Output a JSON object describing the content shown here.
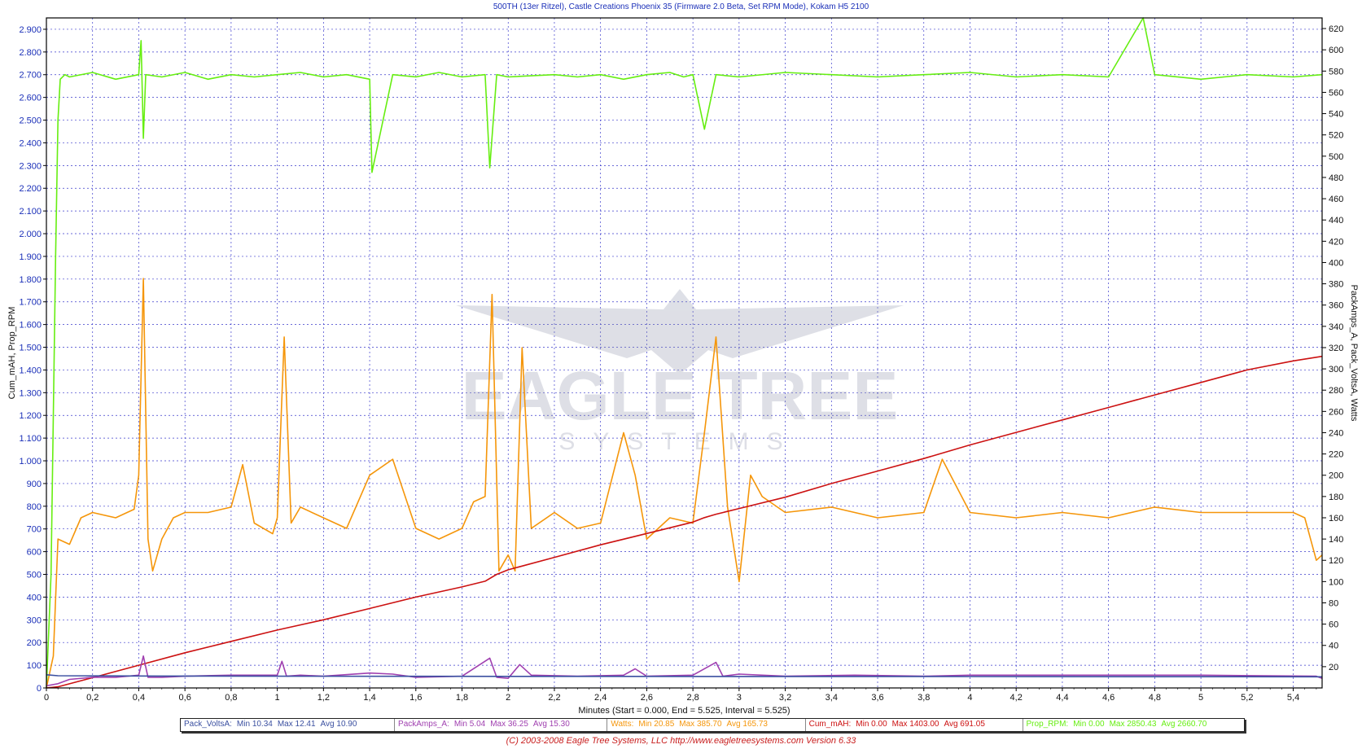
{
  "window": {
    "title": "500TH (13er Ritzel), Castle Creations Phoenix 35 (Firmware 2.0 Beta, Set RPM Mode), Kokam H5 2100"
  },
  "chart_data": {
    "type": "line",
    "title": "500TH (13er Ritzel), Castle Creations Phoenix 35 (Firmware 2.0 Beta, Set RPM Mode), Kokam H5 2100",
    "xlabel": "Minutes (Start = 0.000,  End = 5.525,  Interval =  5.525)",
    "ylabel_left": "Cum_mAH, Prop_RPM",
    "ylabel_right": "PackAmps_A, Pack_VoltsA, Watts",
    "xlim": [
      0,
      5.525
    ],
    "ylim_left": [
      0,
      2950
    ],
    "ylim_right": [
      0,
      630
    ],
    "x_ticks": [
      "0",
      "0,2",
      "0,4",
      "0,6",
      "0,8",
      "1",
      "1,2",
      "1,4",
      "1,6",
      "1,8",
      "2",
      "2,2",
      "2,4",
      "2,6",
      "2,8",
      "3",
      "3,2",
      "3,4",
      "3,6",
      "3,8",
      "4",
      "4,2",
      "4,4",
      "4,6",
      "4,8",
      "5",
      "5,2",
      "5,4"
    ],
    "y_left_ticks": [
      "0",
      "100",
      "200",
      "300",
      "400",
      "500",
      "600",
      "700",
      "800",
      "900",
      "1.000",
      "1.100",
      "1.200",
      "1.300",
      "1.400",
      "1.500",
      "1.600",
      "1.700",
      "1.800",
      "1.900",
      "2.000",
      "2.100",
      "2.200",
      "2.300",
      "2.400",
      "2.500",
      "2.600",
      "2.700",
      "2.800",
      "2.900"
    ],
    "y_right_ticks": [
      "20",
      "40",
      "60",
      "80",
      "100",
      "120",
      "140",
      "160",
      "180",
      "200",
      "220",
      "240",
      "260",
      "280",
      "300",
      "320",
      "340",
      "360",
      "380",
      "400",
      "420",
      "440",
      "460",
      "480",
      "500",
      "520",
      "540",
      "560",
      "580",
      "600",
      "620"
    ],
    "grid": true,
    "legend_position": "bottom",
    "series": [
      {
        "name": "Prop_RPM",
        "axis": "left",
        "color": "#66ee11",
        "x": [
          0,
          0.02,
          0.04,
          0.05,
          0.06,
          0.08,
          0.1,
          0.2,
          0.3,
          0.4,
          0.41,
          0.42,
          0.43,
          0.5,
          0.6,
          0.7,
          0.8,
          0.9,
          1.0,
          1.1,
          1.2,
          1.3,
          1.4,
          1.41,
          1.5,
          1.6,
          1.7,
          1.8,
          1.9,
          1.92,
          1.95,
          2.0,
          2.2,
          2.3,
          2.4,
          2.5,
          2.6,
          2.7,
          2.76,
          2.8,
          2.85,
          2.9,
          3.0,
          3.2,
          3.4,
          3.6,
          3.8,
          4.0,
          4.2,
          4.4,
          4.6,
          4.75,
          4.8,
          5.0,
          5.2,
          5.4,
          5.525
        ],
        "values": [
          0,
          500,
          1900,
          2500,
          2680,
          2700,
          2690,
          2710,
          2680,
          2700,
          2850,
          2420,
          2700,
          2690,
          2710,
          2680,
          2700,
          2690,
          2700,
          2710,
          2690,
          2700,
          2680,
          2270,
          2700,
          2690,
          2710,
          2690,
          2700,
          2290,
          2700,
          2690,
          2700,
          2690,
          2700,
          2680,
          2700,
          2710,
          2690,
          2700,
          2460,
          2700,
          2690,
          2710,
          2700,
          2690,
          2700,
          2710,
          2690,
          2700,
          2690,
          2950,
          2700,
          2680,
          2700,
          2690,
          2700
        ]
      },
      {
        "name": "Watts",
        "axis": "right",
        "color": "#f5960a",
        "x": [
          0,
          0.03,
          0.05,
          0.1,
          0.15,
          0.2,
          0.3,
          0.38,
          0.4,
          0.42,
          0.44,
          0.46,
          0.5,
          0.55,
          0.6,
          0.7,
          0.8,
          0.85,
          0.9,
          0.98,
          1.0,
          1.03,
          1.06,
          1.1,
          1.2,
          1.3,
          1.4,
          1.5,
          1.6,
          1.7,
          1.8,
          1.85,
          1.9,
          1.93,
          1.96,
          2.0,
          2.03,
          2.06,
          2.1,
          2.2,
          2.3,
          2.4,
          2.5,
          2.55,
          2.6,
          2.65,
          2.7,
          2.8,
          2.85,
          2.9,
          2.95,
          3.0,
          3.05,
          3.1,
          3.2,
          3.4,
          3.6,
          3.8,
          3.88,
          4.0,
          4.2,
          4.4,
          4.6,
          4.8,
          5.0,
          5.2,
          5.4,
          5.45,
          5.5,
          5.525
        ],
        "values": [
          0,
          30,
          140,
          135,
          160,
          165,
          160,
          168,
          200,
          385,
          140,
          110,
          140,
          160,
          165,
          165,
          170,
          210,
          155,
          145,
          160,
          330,
          155,
          170,
          160,
          150,
          200,
          215,
          150,
          140,
          150,
          175,
          180,
          370,
          110,
          125,
          110,
          320,
          150,
          165,
          150,
          155,
          240,
          200,
          140,
          150,
          160,
          155,
          240,
          330,
          170,
          100,
          200,
          180,
          165,
          170,
          160,
          165,
          215,
          165,
          160,
          165,
          160,
          170,
          165,
          165,
          165,
          160,
          120,
          125
        ]
      },
      {
        "name": "Cum_mAH",
        "axis": "left",
        "color": "#cc1111",
        "x": [
          0,
          0.05,
          0.2,
          0.4,
          0.6,
          0.8,
          1.0,
          1.2,
          1.4,
          1.6,
          1.8,
          1.9,
          1.95,
          2.0,
          2.2,
          2.4,
          2.6,
          2.7,
          2.8,
          2.85,
          2.9,
          3.0,
          3.2,
          3.4,
          3.6,
          3.8,
          4.0,
          4.2,
          4.4,
          4.6,
          4.8,
          5.0,
          5.2,
          5.4,
          5.525
        ],
        "values": [
          0,
          5,
          45,
          100,
          155,
          205,
          255,
          300,
          350,
          400,
          445,
          470,
          500,
          520,
          575,
          630,
          680,
          705,
          730,
          750,
          765,
          790,
          840,
          900,
          955,
          1010,
          1070,
          1125,
          1180,
          1235,
          1290,
          1345,
          1400,
          1440,
          1460
        ]
      },
      {
        "name": "PackAmps_A",
        "axis": "right",
        "color": "#a040b0",
        "x": [
          0,
          0.05,
          0.1,
          0.2,
          0.3,
          0.4,
          0.42,
          0.44,
          0.5,
          0.6,
          0.8,
          1.0,
          1.02,
          1.04,
          1.1,
          1.2,
          1.4,
          1.5,
          1.6,
          1.8,
          1.92,
          1.95,
          2.0,
          2.05,
          2.1,
          2.3,
          2.5,
          2.55,
          2.6,
          2.8,
          2.9,
          2.93,
          3.0,
          3.2,
          3.5,
          3.8,
          4.0,
          4.5,
          5.0,
          5.5,
          5.525
        ],
        "values": [
          2,
          4,
          8,
          10,
          10,
          12,
          30,
          10,
          10,
          11,
          12,
          12,
          25,
          11,
          12,
          11,
          14,
          13,
          10,
          11,
          28,
          10,
          9,
          22,
          12,
          11,
          12,
          18,
          11,
          12,
          24,
          11,
          13,
          11,
          12,
          11,
          12,
          12,
          12,
          11,
          9
        ]
      },
      {
        "name": "Pack_VoltsA",
        "axis": "right",
        "color": "#3a4fa0",
        "x": [
          0,
          0.05,
          0.5,
          1.0,
          2.0,
          3.0,
          4.0,
          5.0,
          5.525
        ],
        "values": [
          12.4,
          11.5,
          11.2,
          11.0,
          10.9,
          10.8,
          10.7,
          10.6,
          10.5
        ]
      }
    ]
  },
  "legend": [
    {
      "name": "Pack_VoltsA:",
      "min": "Min 10.34",
      "max": "Max 12.41",
      "avg": "Avg 10.90",
      "color": "#3a4fa0"
    },
    {
      "name": "PackAmps_A:",
      "min": "Min 5.04",
      "max": "Max 36.25",
      "avg": "Avg 15.30",
      "color": "#a040b0"
    },
    {
      "name": "Watts:",
      "min": "Min 20.85",
      "max": "Max 385.70",
      "avg": "Avg 165.73",
      "color": "#f5960a"
    },
    {
      "name": "Cum_mAH:",
      "min": "Min 0.00",
      "max": "Max 1403.00",
      "avg": "Avg 691.05",
      "color": "#cc1111"
    },
    {
      "name": "Prop_RPM:",
      "min": "Min 0.00",
      "max": "Max 2850.43",
      "avg": "Avg 2660.70",
      "color": "#66ee11"
    }
  ],
  "footer": "(C) 2003-2008 Eagle Tree Systems, LLC     http://www.eagletreesystems.com     Version 6.33",
  "watermark": {
    "line1": "EAGLE TREE",
    "line2": "SYSTEMS"
  }
}
